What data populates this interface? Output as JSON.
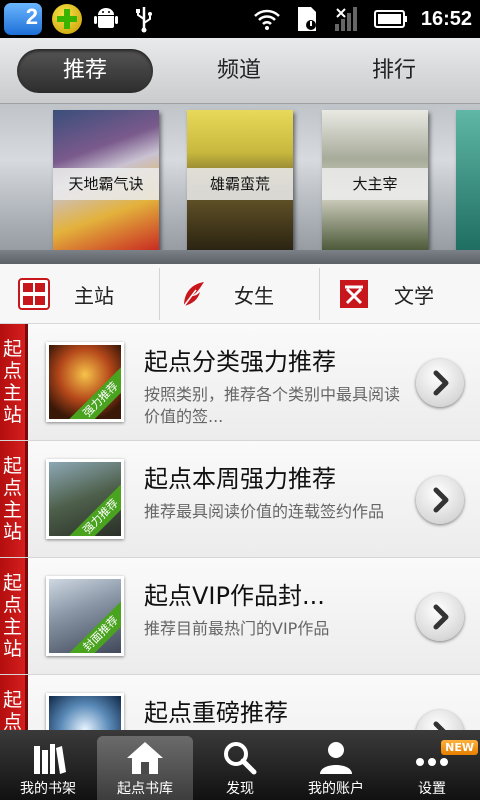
{
  "status_bar": {
    "time": "16:52",
    "badge_count": "2",
    "icons": [
      "app-badge-icon",
      "plus-app-icon",
      "android-icon",
      "usb-icon",
      "wifi-icon",
      "sd-card-icon",
      "signal-icon",
      "battery-icon"
    ]
  },
  "top_tabs": [
    {
      "label": "推荐",
      "active": true
    },
    {
      "label": "频道",
      "active": false
    },
    {
      "label": "排行",
      "active": false
    }
  ],
  "featured_books": [
    {
      "title": "天地霸气诀"
    },
    {
      "title": "雄霸蛮荒"
    },
    {
      "title": "大主宰"
    }
  ],
  "channels": [
    {
      "label": "主站",
      "icon": "qidian-icon"
    },
    {
      "label": "女生",
      "icon": "feather-icon"
    },
    {
      "label": "文学",
      "icon": "wenxue-icon"
    }
  ],
  "list_items": [
    {
      "tag": "起点主站",
      "title": "起点分类强力推荐",
      "desc": "按照类别，推荐各个类别中最具阅读价值的签...",
      "ribbon": "强力推荐"
    },
    {
      "tag": "起点主站",
      "title": "起点本周强力推荐",
      "desc": "推荐最具阅读价值的连载签约作品",
      "ribbon": "强力推荐"
    },
    {
      "tag": "起点主站",
      "title": "起点VIP作品封...",
      "desc": "推荐目前最热门的VIP作品",
      "ribbon": "封面推荐"
    },
    {
      "tag": "起点",
      "title": "起点重磅推荐",
      "desc": "",
      "ribbon": ""
    }
  ],
  "bottom_nav": [
    {
      "label": "我的书架",
      "icon": "bookshelf-icon",
      "active": false
    },
    {
      "label": "起点书库",
      "icon": "home-icon",
      "active": true
    },
    {
      "label": "发现",
      "icon": "search-icon",
      "active": false
    },
    {
      "label": "我的账户",
      "icon": "user-icon",
      "active": false
    },
    {
      "label": "设置",
      "icon": "more-icon",
      "active": false,
      "badge": "NEW"
    }
  ],
  "colors": {
    "accent_red": "#c8161d",
    "active_tab_bg": "#333333",
    "ribbon_green": "#4aa31f"
  }
}
